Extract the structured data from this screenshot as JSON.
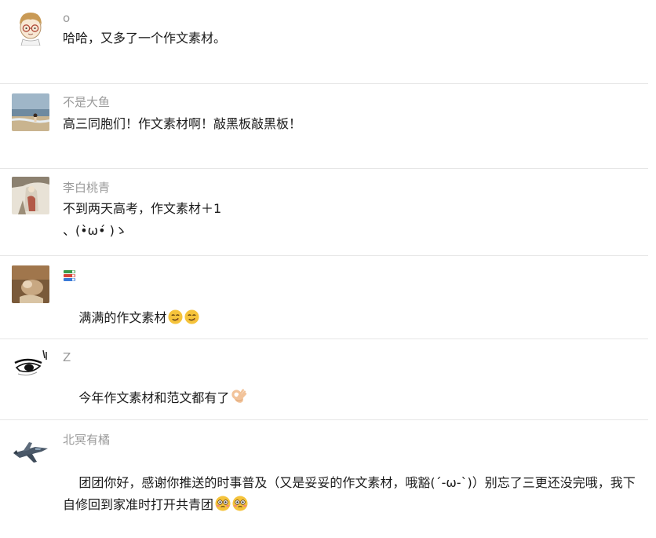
{
  "comments": [
    {
      "nickname": "o",
      "text": "哈哈，又多了一个作文素材。",
      "avatar": "cartoon-boy-glasses-avatar"
    },
    {
      "nickname": "不是大鱼",
      "text": "高三同胞们！作文素材啊！敲黑板敲黑板！",
      "avatar": "beach-photo-avatar"
    },
    {
      "nickname": "李白桃青",
      "text": "不到两天高考，作文素材＋1\n、(•̀ω•́ )ゝ",
      "avatar": "painting-avatar"
    },
    {
      "nickname": "",
      "nickname_icon": "books-icon",
      "text": "满满的作文素材",
      "avatar": "doll-photo-avatar",
      "emojis": [
        "smirk-emoji",
        "smirk-emoji"
      ]
    },
    {
      "nickname": "Z",
      "text": "今年作文素材和范文都有了",
      "avatar": "eye-sketch-avatar",
      "emojis": [
        "ok-hand-emoji"
      ]
    },
    {
      "nickname": "北冥有橘",
      "text": "团团你好，感谢你推送的时事普及（又是妥妥的作文素材，哦豁(´-ω-`)）别忘了三更还没完哦，我下自修回到家准时打开共青团",
      "avatar": "jet-avatar",
      "emojis": [
        "embarrassed-emoji",
        "embarrassed-emoji"
      ]
    }
  ]
}
